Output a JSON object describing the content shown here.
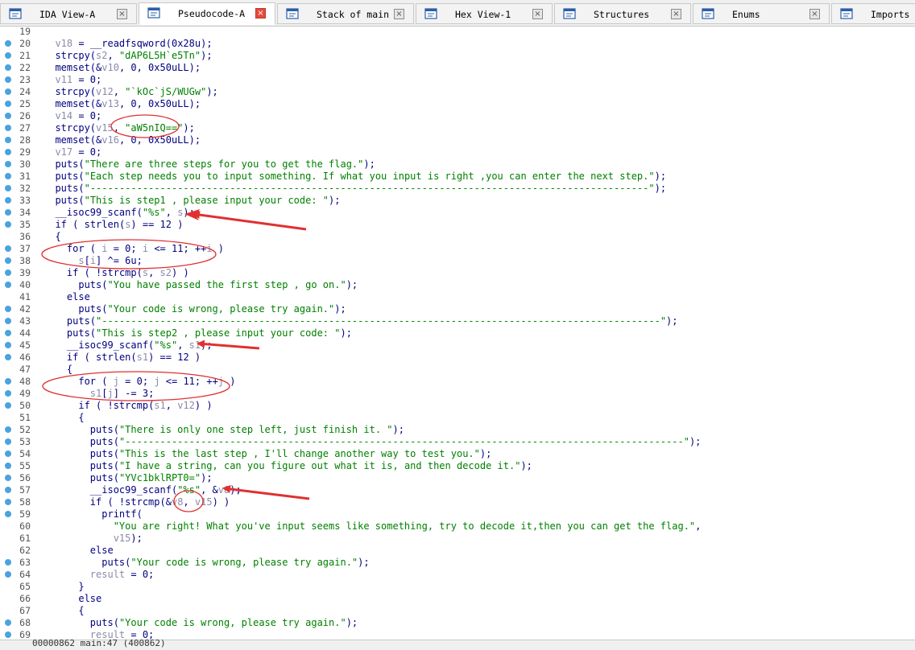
{
  "tabs": [
    {
      "label": "IDA View-A",
      "icon": "ida-view-icon",
      "active": false
    },
    {
      "label": "Pseudocode-A",
      "icon": "pseudocode-icon",
      "active": true
    },
    {
      "label": "Stack of main",
      "icon": "stack-icon",
      "active": false
    },
    {
      "label": "Hex View-1",
      "icon": "hex-view-icon",
      "active": false
    },
    {
      "label": "Structures",
      "icon": "structures-icon",
      "active": false
    },
    {
      "label": "Enums",
      "icon": "enums-icon",
      "active": false
    },
    {
      "label": "Imports",
      "icon": "imports-icon",
      "active": false
    }
  ],
  "close_glyph": "×",
  "code_lines": [
    {
      "n": "19",
      "dot": false,
      "tokens": []
    },
    {
      "n": "20",
      "dot": true,
      "tokens": [
        [
          "v",
          "  v18"
        ],
        [
          "p",
          " = "
        ],
        [
          "k",
          "__readfsqword"
        ],
        [
          "p",
          "("
        ],
        [
          "n",
          "0x28u"
        ],
        [
          "p",
          ");"
        ]
      ]
    },
    {
      "n": "21",
      "dot": true,
      "tokens": [
        [
          "k",
          "  strcpy"
        ],
        [
          "p",
          "("
        ],
        [
          "v",
          "s2"
        ],
        [
          "p",
          ", "
        ],
        [
          "s",
          "\"dAP6L5H`e5Tn\""
        ],
        [
          "p",
          ");"
        ]
      ]
    },
    {
      "n": "22",
      "dot": true,
      "tokens": [
        [
          "k",
          "  memset"
        ],
        [
          "p",
          "(&"
        ],
        [
          "v",
          "v10"
        ],
        [
          "p",
          ", 0, 0x50uLL);"
        ]
      ]
    },
    {
      "n": "23",
      "dot": true,
      "tokens": [
        [
          "v",
          "  v11"
        ],
        [
          "p",
          " = 0;"
        ]
      ]
    },
    {
      "n": "24",
      "dot": true,
      "tokens": [
        [
          "k",
          "  strcpy"
        ],
        [
          "p",
          "("
        ],
        [
          "v",
          "v12"
        ],
        [
          "p",
          ", "
        ],
        [
          "s",
          "\"`kOc`jS/WUGw\""
        ],
        [
          "p",
          ");"
        ]
      ]
    },
    {
      "n": "25",
      "dot": true,
      "tokens": [
        [
          "k",
          "  memset"
        ],
        [
          "p",
          "(&"
        ],
        [
          "v",
          "v13"
        ],
        [
          "p",
          ", 0, 0x50uLL);"
        ]
      ]
    },
    {
      "n": "26",
      "dot": true,
      "tokens": [
        [
          "v",
          "  v14"
        ],
        [
          "p",
          " = 0;"
        ]
      ]
    },
    {
      "n": "27",
      "dot": true,
      "tokens": [
        [
          "k",
          "  strcpy"
        ],
        [
          "p",
          "("
        ],
        [
          "v",
          "v15"
        ],
        [
          "p",
          ", "
        ],
        [
          "s",
          "\"aW5nIQ==\""
        ],
        [
          "p",
          ");"
        ]
      ]
    },
    {
      "n": "28",
      "dot": true,
      "tokens": [
        [
          "k",
          "  memset"
        ],
        [
          "p",
          "(&"
        ],
        [
          "v",
          "v16"
        ],
        [
          "p",
          ", 0, 0x50uLL);"
        ]
      ]
    },
    {
      "n": "29",
      "dot": true,
      "tokens": [
        [
          "v",
          "  v17"
        ],
        [
          "p",
          " = 0;"
        ]
      ]
    },
    {
      "n": "30",
      "dot": true,
      "tokens": [
        [
          "k",
          "  puts"
        ],
        [
          "p",
          "("
        ],
        [
          "s",
          "\"There are three steps for you to get the flag.\""
        ],
        [
          "p",
          ");"
        ]
      ]
    },
    {
      "n": "31",
      "dot": true,
      "tokens": [
        [
          "k",
          "  puts"
        ],
        [
          "p",
          "("
        ],
        [
          "s",
          "\"Each step needs you to input something. If what you input is right ,you can enter the next step.\""
        ],
        [
          "p",
          ");"
        ]
      ]
    },
    {
      "n": "32",
      "dot": true,
      "tokens": [
        [
          "k",
          "  puts"
        ],
        [
          "p",
          "("
        ],
        [
          "s",
          "\"------------------------------------------------------------------------------------------------\""
        ],
        [
          "p",
          ");"
        ]
      ]
    },
    {
      "n": "33",
      "dot": true,
      "tokens": [
        [
          "k",
          "  puts"
        ],
        [
          "p",
          "("
        ],
        [
          "s",
          "\"This is step1 , please input your code: \""
        ],
        [
          "p",
          ");"
        ]
      ]
    },
    {
      "n": "34",
      "dot": true,
      "tokens": [
        [
          "k",
          "  __isoc99_scanf"
        ],
        [
          "p",
          "("
        ],
        [
          "s",
          "\"%s\""
        ],
        [
          "p",
          ", "
        ],
        [
          "v",
          "s"
        ],
        [
          "p",
          ");"
        ]
      ]
    },
    {
      "n": "35",
      "dot": true,
      "tokens": [
        [
          "k",
          "  if"
        ],
        [
          "p",
          " ( "
        ],
        [
          "k",
          "strlen"
        ],
        [
          "p",
          "("
        ],
        [
          "v",
          "s"
        ],
        [
          "p",
          ") == 12 )"
        ]
      ]
    },
    {
      "n": "36",
      "dot": false,
      "tokens": [
        [
          "p",
          "  {"
        ]
      ]
    },
    {
      "n": "37",
      "dot": true,
      "tokens": [
        [
          "k",
          "    for"
        ],
        [
          "p",
          " ( "
        ],
        [
          "v",
          "i"
        ],
        [
          "p",
          " = 0; "
        ],
        [
          "v",
          "i"
        ],
        [
          "p",
          " <= 11; ++"
        ],
        [
          "v",
          "i"
        ],
        [
          "p",
          " )"
        ]
      ]
    },
    {
      "n": "38",
      "dot": true,
      "tokens": [
        [
          "v",
          "      s"
        ],
        [
          "p",
          "["
        ],
        [
          "v",
          "i"
        ],
        [
          "p",
          "] ^= 6u;"
        ]
      ]
    },
    {
      "n": "39",
      "dot": true,
      "tokens": [
        [
          "k",
          "    if"
        ],
        [
          "p",
          " ( !"
        ],
        [
          "k",
          "strcmp"
        ],
        [
          "p",
          "("
        ],
        [
          "v",
          "s"
        ],
        [
          "p",
          ", "
        ],
        [
          "v",
          "s2"
        ],
        [
          "p",
          ") )"
        ]
      ]
    },
    {
      "n": "40",
      "dot": true,
      "tokens": [
        [
          "k",
          "      puts"
        ],
        [
          "p",
          "("
        ],
        [
          "s",
          "\"You have passed the first step , go on.\""
        ],
        [
          "p",
          ");"
        ]
      ]
    },
    {
      "n": "41",
      "dot": false,
      "tokens": [
        [
          "k",
          "    else"
        ]
      ]
    },
    {
      "n": "42",
      "dot": true,
      "tokens": [
        [
          "k",
          "      puts"
        ],
        [
          "p",
          "("
        ],
        [
          "s",
          "\"Your code is wrong, please try again.\""
        ],
        [
          "p",
          ");"
        ]
      ]
    },
    {
      "n": "43",
      "dot": true,
      "tokens": [
        [
          "k",
          "    puts"
        ],
        [
          "p",
          "("
        ],
        [
          "s",
          "\"------------------------------------------------------------------------------------------------\""
        ],
        [
          "p",
          ");"
        ]
      ]
    },
    {
      "n": "44",
      "dot": true,
      "tokens": [
        [
          "k",
          "    puts"
        ],
        [
          "p",
          "("
        ],
        [
          "s",
          "\"This is step2 , please input your code: \""
        ],
        [
          "p",
          ");"
        ]
      ]
    },
    {
      "n": "45",
      "dot": true,
      "tokens": [
        [
          "k",
          "    __isoc99_scanf"
        ],
        [
          "p",
          "("
        ],
        [
          "s",
          "\"%s\""
        ],
        [
          "p",
          ", "
        ],
        [
          "v",
          "s1"
        ],
        [
          "p",
          ");"
        ]
      ]
    },
    {
      "n": "46",
      "dot": true,
      "tokens": [
        [
          "k",
          "    if"
        ],
        [
          "p",
          " ( "
        ],
        [
          "k",
          "strlen"
        ],
        [
          "p",
          "("
        ],
        [
          "v",
          "s1"
        ],
        [
          "p",
          ") == 12 )"
        ]
      ]
    },
    {
      "n": "47",
      "dot": false,
      "tokens": [
        [
          "p",
          "    {"
        ]
      ]
    },
    {
      "n": "48",
      "dot": true,
      "tokens": [
        [
          "k",
          "      for"
        ],
        [
          "p",
          " ( "
        ],
        [
          "v",
          "j"
        ],
        [
          "p",
          " = 0; "
        ],
        [
          "v",
          "j"
        ],
        [
          "p",
          " <= 11; ++"
        ],
        [
          "v",
          "j"
        ],
        [
          "p",
          " )"
        ]
      ]
    },
    {
      "n": "49",
      "dot": true,
      "tokens": [
        [
          "v",
          "        s1"
        ],
        [
          "p",
          "["
        ],
        [
          "v",
          "j"
        ],
        [
          "p",
          "] -= 3;"
        ]
      ]
    },
    {
      "n": "50",
      "dot": true,
      "tokens": [
        [
          "k",
          "      if"
        ],
        [
          "p",
          " ( !"
        ],
        [
          "k",
          "strcmp"
        ],
        [
          "p",
          "("
        ],
        [
          "v",
          "s1"
        ],
        [
          "p",
          ", "
        ],
        [
          "v",
          "v12"
        ],
        [
          "p",
          ") )"
        ]
      ]
    },
    {
      "n": "51",
      "dot": false,
      "tokens": [
        [
          "p",
          "      {"
        ]
      ]
    },
    {
      "n": "52",
      "dot": true,
      "tokens": [
        [
          "k",
          "        puts"
        ],
        [
          "p",
          "("
        ],
        [
          "s",
          "\"There is only one step left, just finish it. \""
        ],
        [
          "p",
          ");"
        ]
      ]
    },
    {
      "n": "53",
      "dot": true,
      "tokens": [
        [
          "k",
          "        puts"
        ],
        [
          "p",
          "("
        ],
        [
          "s",
          "\"------------------------------------------------------------------------------------------------\""
        ],
        [
          "p",
          ");"
        ]
      ]
    },
    {
      "n": "54",
      "dot": true,
      "tokens": [
        [
          "k",
          "        puts"
        ],
        [
          "p",
          "("
        ],
        [
          "s",
          "\"This is the last step , I'll change another way to test you.\""
        ],
        [
          "p",
          ");"
        ]
      ]
    },
    {
      "n": "55",
      "dot": true,
      "tokens": [
        [
          "k",
          "        puts"
        ],
        [
          "p",
          "("
        ],
        [
          "s",
          "\"I have a string, can you figure out what it is, and then decode it.\""
        ],
        [
          "p",
          ");"
        ]
      ]
    },
    {
      "n": "56",
      "dot": true,
      "tokens": [
        [
          "k",
          "        puts"
        ],
        [
          "p",
          "("
        ],
        [
          "s",
          "\"YVc1bklRPT0=\""
        ],
        [
          "p",
          ");"
        ]
      ]
    },
    {
      "n": "57",
      "dot": true,
      "tokens": [
        [
          "k",
          "        __isoc99_scanf"
        ],
        [
          "p",
          "("
        ],
        [
          "s",
          "\"%s\""
        ],
        [
          "p",
          ", &"
        ],
        [
          "v",
          "v8"
        ],
        [
          "p",
          ");"
        ]
      ]
    },
    {
      "n": "58",
      "dot": true,
      "tokens": [
        [
          "k",
          "        if"
        ],
        [
          "p",
          " ( !"
        ],
        [
          "k",
          "strcmp"
        ],
        [
          "p",
          "(&"
        ],
        [
          "v",
          "v8"
        ],
        [
          "p",
          ", "
        ],
        [
          "v",
          "v15"
        ],
        [
          "p",
          ") )"
        ]
      ]
    },
    {
      "n": "59",
      "dot": true,
      "tokens": [
        [
          "k",
          "          printf"
        ],
        [
          "p",
          "("
        ]
      ]
    },
    {
      "n": "60",
      "dot": false,
      "tokens": [
        [
          "s",
          "            \"You are right! What you've input seems like something, try to decode it,then you can get the flag.\""
        ],
        [
          "p",
          ","
        ]
      ]
    },
    {
      "n": "61",
      "dot": false,
      "tokens": [
        [
          "v",
          "            v15"
        ],
        [
          "p",
          ");"
        ]
      ]
    },
    {
      "n": "62",
      "dot": false,
      "tokens": [
        [
          "k",
          "        else"
        ]
      ]
    },
    {
      "n": "63",
      "dot": true,
      "tokens": [
        [
          "k",
          "          puts"
        ],
        [
          "p",
          "("
        ],
        [
          "s",
          "\"Your code is wrong, please try again.\""
        ],
        [
          "p",
          ");"
        ]
      ]
    },
    {
      "n": "64",
      "dot": true,
      "tokens": [
        [
          "v",
          "        result"
        ],
        [
          "p",
          " = 0;"
        ]
      ]
    },
    {
      "n": "65",
      "dot": false,
      "tokens": [
        [
          "p",
          "      }"
        ]
      ]
    },
    {
      "n": "66",
      "dot": false,
      "tokens": [
        [
          "k",
          "      else"
        ]
      ]
    },
    {
      "n": "67",
      "dot": false,
      "tokens": [
        [
          "p",
          "      {"
        ]
      ]
    },
    {
      "n": "68",
      "dot": true,
      "tokens": [
        [
          "k",
          "        puts"
        ],
        [
          "p",
          "("
        ],
        [
          "s",
          "\"Your code is wrong, please try again.\""
        ],
        [
          "p",
          ");"
        ]
      ]
    },
    {
      "n": "69",
      "dot": true,
      "tokens": [
        [
          "v",
          "        result"
        ],
        [
          "p",
          " = 0;"
        ]
      ]
    }
  ],
  "status": "00000862 main:47 (400862)",
  "annotation_color": "#e03030",
  "line_dot_color": "#4aa3df"
}
